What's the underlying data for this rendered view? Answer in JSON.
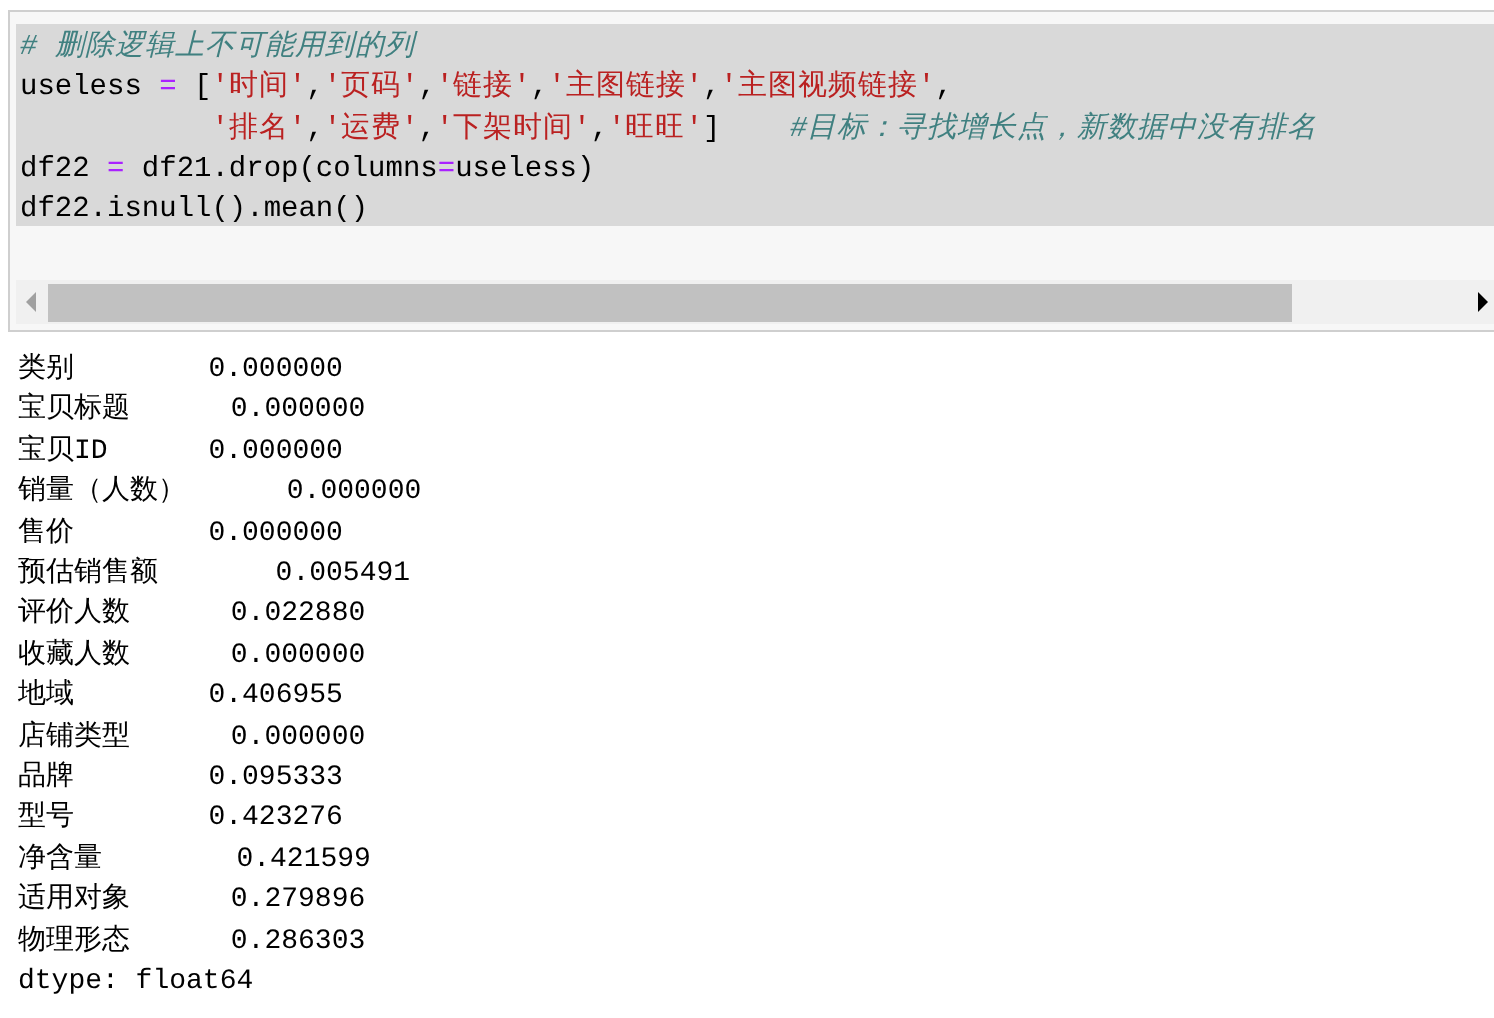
{
  "code_cell": {
    "lines": [
      [
        {
          "kind": "comment",
          "text": "# 删除逻辑上不可能用到的列"
        }
      ],
      [
        {
          "kind": "name",
          "text": "useless "
        },
        {
          "kind": "operator",
          "text": "="
        },
        {
          "kind": "name",
          "text": " ["
        },
        {
          "kind": "string",
          "text": "'时间'"
        },
        {
          "kind": "name",
          "text": ","
        },
        {
          "kind": "string",
          "text": "'页码'"
        },
        {
          "kind": "name",
          "text": ","
        },
        {
          "kind": "string",
          "text": "'链接'"
        },
        {
          "kind": "name",
          "text": ","
        },
        {
          "kind": "string",
          "text": "'主图链接'"
        },
        {
          "kind": "name",
          "text": ","
        },
        {
          "kind": "string",
          "text": "'主图视频链接'"
        },
        {
          "kind": "name",
          "text": ","
        }
      ],
      [
        {
          "kind": "string",
          "text": "           '排名'"
        },
        {
          "kind": "name",
          "text": ","
        },
        {
          "kind": "string",
          "text": "'运费'"
        },
        {
          "kind": "name",
          "text": ","
        },
        {
          "kind": "string",
          "text": "'下架时间'"
        },
        {
          "kind": "name",
          "text": ","
        },
        {
          "kind": "string",
          "text": "'旺旺'"
        },
        {
          "kind": "name",
          "text": "]    "
        },
        {
          "kind": "comment",
          "text": "#目标：寻找增长点，新数据中没有排名"
        }
      ],
      [
        {
          "kind": "name",
          "text": "df22 "
        },
        {
          "kind": "operator",
          "text": "="
        },
        {
          "kind": "name",
          "text": " df21.drop(columns"
        },
        {
          "kind": "operator",
          "text": "="
        },
        {
          "kind": "name",
          "text": "useless)"
        }
      ],
      [
        {
          "kind": "name",
          "text": "df22.isnull().mean()"
        }
      ]
    ]
  },
  "output": {
    "lines": [
      "类别        0.000000",
      "宝贝标题      0.000000",
      "宝贝ID      0.000000",
      "销量（人数）      0.000000",
      "售价        0.000000",
      "预估销售额       0.005491",
      "评价人数      0.022880",
      "收藏人数      0.000000",
      "地域        0.406955",
      "店铺类型      0.000000",
      "品牌        0.095333",
      "型号        0.423276",
      "净含量        0.421599",
      "适用对象      0.279896",
      "物理形态      0.286303",
      "dtype: float64"
    ]
  }
}
